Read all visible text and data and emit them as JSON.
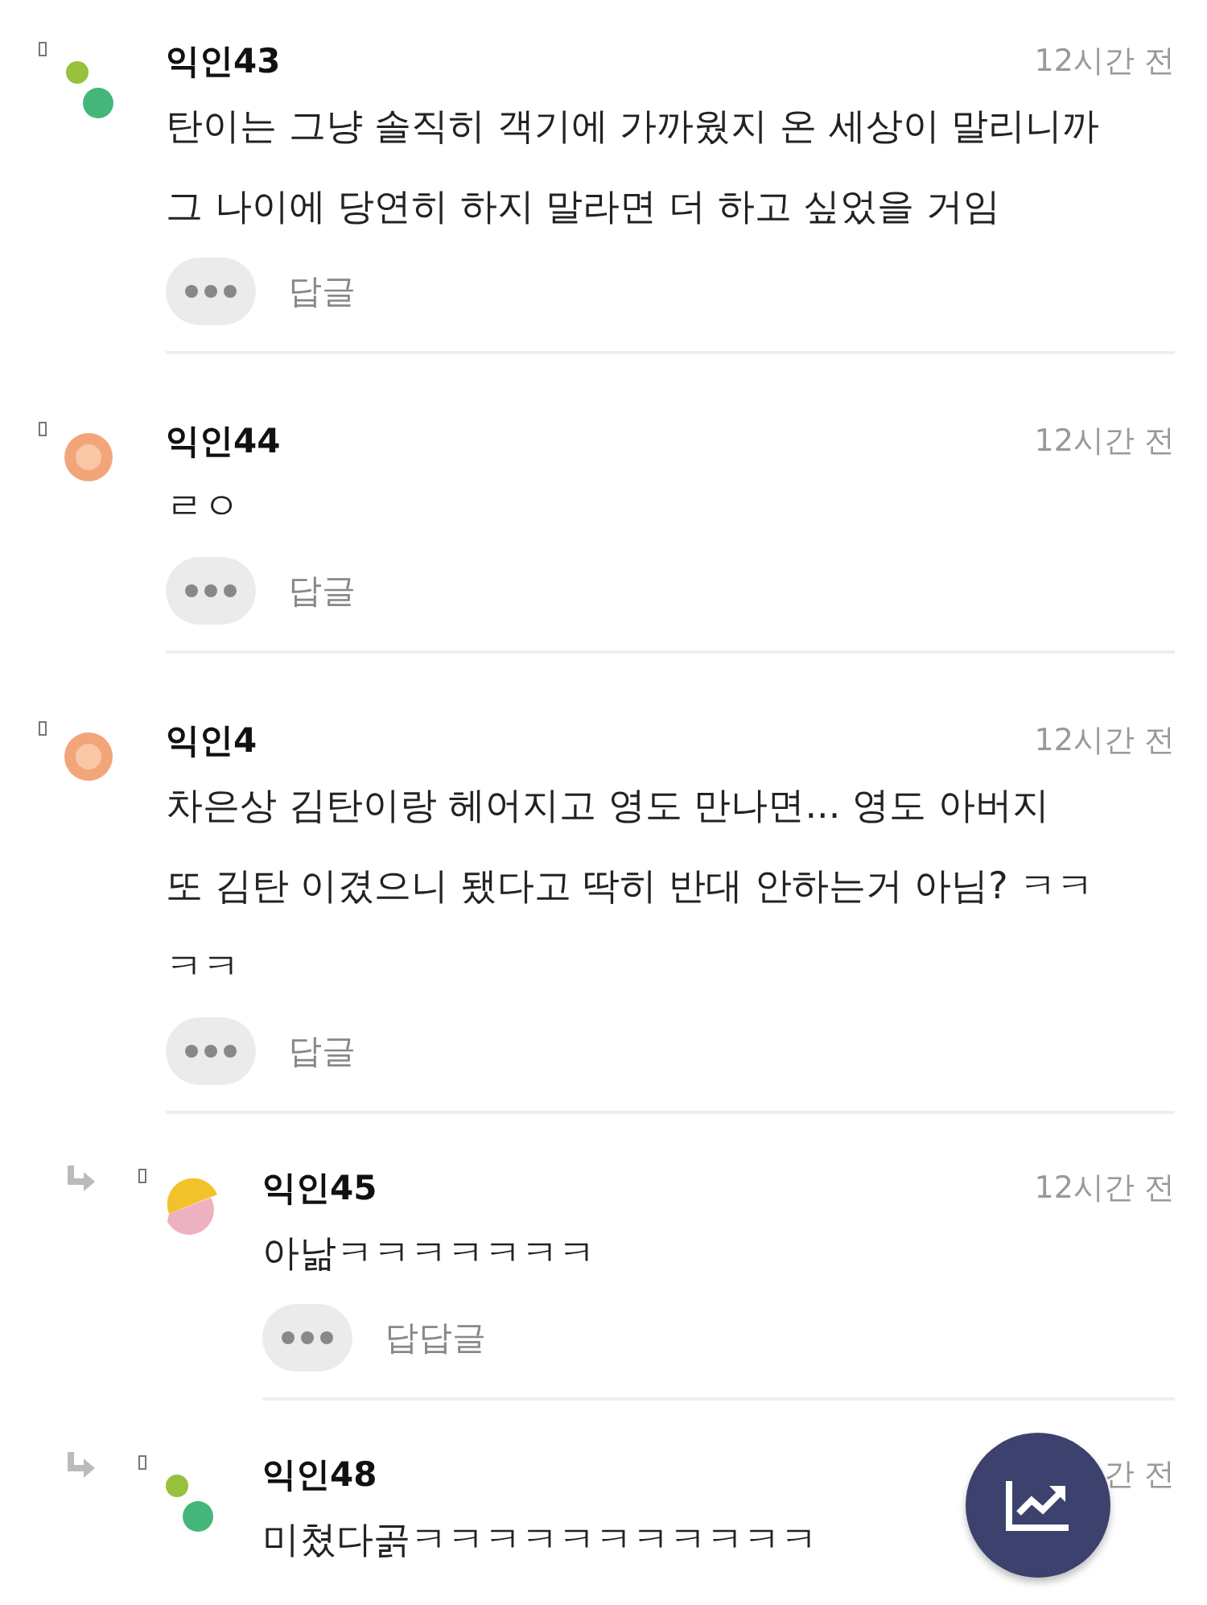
{
  "comments": [
    {
      "kind": "dots",
      "reply": false,
      "name": "익인43",
      "time": "12시간 전",
      "body": [
        "탄이는 그냥 솔직히 객기에 가까웠지 온 세상이 말리니까",
        "그 나이에 당연히 하지 말라면 더 하고 싶었을 거임"
      ],
      "action": "답글"
    },
    {
      "kind": "ring",
      "reply": false,
      "name": "익인44",
      "time": "12시간 전",
      "body": [
        "ㄹㅇ"
      ],
      "action": "답글"
    },
    {
      "kind": "ring",
      "reply": false,
      "name": "익인4",
      "time": "12시간 전",
      "body": [
        "차은상 김탄이랑 헤어지고 영도 만나면... 영도 아버지",
        "또 김탄 이겼으니 됐다고 딱히 반대 안하는거 아님? ㅋㅋ",
        "ㅋㅋ"
      ],
      "action": "답글"
    },
    {
      "kind": "halves",
      "reply": true,
      "name": "익인45",
      "time": "12시간 전",
      "body": [
        "아낢ㅋㅋㅋㅋㅋㅋㅋ"
      ],
      "action": "답답글"
    },
    {
      "kind": "dots",
      "reply": true,
      "name": "익인48",
      "time": "간 전",
      "body": [
        "미쳤다곩ㅋㅋㅋㅋㅋㅋㅋㅋㅋㅋㅋ"
      ]
    }
  ]
}
